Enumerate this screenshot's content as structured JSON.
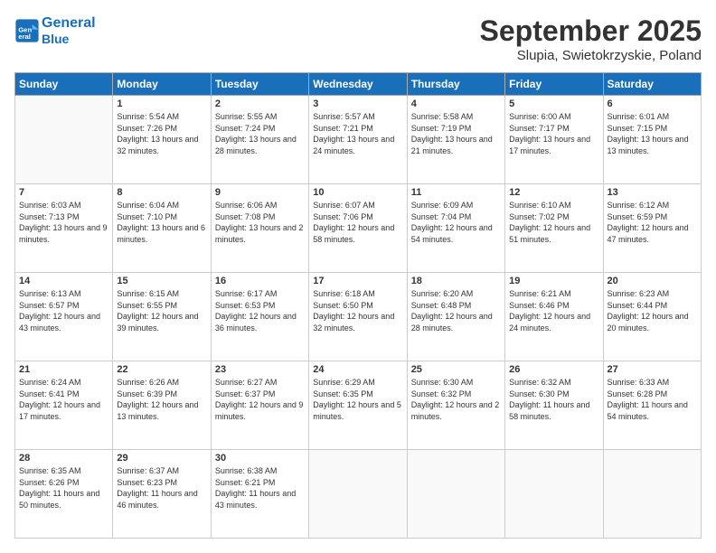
{
  "header": {
    "logo_line1": "General",
    "logo_line2": "Blue",
    "month": "September 2025",
    "location": "Slupia, Swietokrzyskie, Poland"
  },
  "weekdays": [
    "Sunday",
    "Monday",
    "Tuesday",
    "Wednesday",
    "Thursday",
    "Friday",
    "Saturday"
  ],
  "weeks": [
    [
      {
        "day": "",
        "sunrise": "",
        "sunset": "",
        "daylight": ""
      },
      {
        "day": "1",
        "sunrise": "Sunrise: 5:54 AM",
        "sunset": "Sunset: 7:26 PM",
        "daylight": "Daylight: 13 hours and 32 minutes."
      },
      {
        "day": "2",
        "sunrise": "Sunrise: 5:55 AM",
        "sunset": "Sunset: 7:24 PM",
        "daylight": "Daylight: 13 hours and 28 minutes."
      },
      {
        "day": "3",
        "sunrise": "Sunrise: 5:57 AM",
        "sunset": "Sunset: 7:21 PM",
        "daylight": "Daylight: 13 hours and 24 minutes."
      },
      {
        "day": "4",
        "sunrise": "Sunrise: 5:58 AM",
        "sunset": "Sunset: 7:19 PM",
        "daylight": "Daylight: 13 hours and 21 minutes."
      },
      {
        "day": "5",
        "sunrise": "Sunrise: 6:00 AM",
        "sunset": "Sunset: 7:17 PM",
        "daylight": "Daylight: 13 hours and 17 minutes."
      },
      {
        "day": "6",
        "sunrise": "Sunrise: 6:01 AM",
        "sunset": "Sunset: 7:15 PM",
        "daylight": "Daylight: 13 hours and 13 minutes."
      }
    ],
    [
      {
        "day": "7",
        "sunrise": "Sunrise: 6:03 AM",
        "sunset": "Sunset: 7:13 PM",
        "daylight": "Daylight: 13 hours and 9 minutes."
      },
      {
        "day": "8",
        "sunrise": "Sunrise: 6:04 AM",
        "sunset": "Sunset: 7:10 PM",
        "daylight": "Daylight: 13 hours and 6 minutes."
      },
      {
        "day": "9",
        "sunrise": "Sunrise: 6:06 AM",
        "sunset": "Sunset: 7:08 PM",
        "daylight": "Daylight: 13 hours and 2 minutes."
      },
      {
        "day": "10",
        "sunrise": "Sunrise: 6:07 AM",
        "sunset": "Sunset: 7:06 PM",
        "daylight": "Daylight: 12 hours and 58 minutes."
      },
      {
        "day": "11",
        "sunrise": "Sunrise: 6:09 AM",
        "sunset": "Sunset: 7:04 PM",
        "daylight": "Daylight: 12 hours and 54 minutes."
      },
      {
        "day": "12",
        "sunrise": "Sunrise: 6:10 AM",
        "sunset": "Sunset: 7:02 PM",
        "daylight": "Daylight: 12 hours and 51 minutes."
      },
      {
        "day": "13",
        "sunrise": "Sunrise: 6:12 AM",
        "sunset": "Sunset: 6:59 PM",
        "daylight": "Daylight: 12 hours and 47 minutes."
      }
    ],
    [
      {
        "day": "14",
        "sunrise": "Sunrise: 6:13 AM",
        "sunset": "Sunset: 6:57 PM",
        "daylight": "Daylight: 12 hours and 43 minutes."
      },
      {
        "day": "15",
        "sunrise": "Sunrise: 6:15 AM",
        "sunset": "Sunset: 6:55 PM",
        "daylight": "Daylight: 12 hours and 39 minutes."
      },
      {
        "day": "16",
        "sunrise": "Sunrise: 6:17 AM",
        "sunset": "Sunset: 6:53 PM",
        "daylight": "Daylight: 12 hours and 36 minutes."
      },
      {
        "day": "17",
        "sunrise": "Sunrise: 6:18 AM",
        "sunset": "Sunset: 6:50 PM",
        "daylight": "Daylight: 12 hours and 32 minutes."
      },
      {
        "day": "18",
        "sunrise": "Sunrise: 6:20 AM",
        "sunset": "Sunset: 6:48 PM",
        "daylight": "Daylight: 12 hours and 28 minutes."
      },
      {
        "day": "19",
        "sunrise": "Sunrise: 6:21 AM",
        "sunset": "Sunset: 6:46 PM",
        "daylight": "Daylight: 12 hours and 24 minutes."
      },
      {
        "day": "20",
        "sunrise": "Sunrise: 6:23 AM",
        "sunset": "Sunset: 6:44 PM",
        "daylight": "Daylight: 12 hours and 20 minutes."
      }
    ],
    [
      {
        "day": "21",
        "sunrise": "Sunrise: 6:24 AM",
        "sunset": "Sunset: 6:41 PM",
        "daylight": "Daylight: 12 hours and 17 minutes."
      },
      {
        "day": "22",
        "sunrise": "Sunrise: 6:26 AM",
        "sunset": "Sunset: 6:39 PM",
        "daylight": "Daylight: 12 hours and 13 minutes."
      },
      {
        "day": "23",
        "sunrise": "Sunrise: 6:27 AM",
        "sunset": "Sunset: 6:37 PM",
        "daylight": "Daylight: 12 hours and 9 minutes."
      },
      {
        "day": "24",
        "sunrise": "Sunrise: 6:29 AM",
        "sunset": "Sunset: 6:35 PM",
        "daylight": "Daylight: 12 hours and 5 minutes."
      },
      {
        "day": "25",
        "sunrise": "Sunrise: 6:30 AM",
        "sunset": "Sunset: 6:32 PM",
        "daylight": "Daylight: 12 hours and 2 minutes."
      },
      {
        "day": "26",
        "sunrise": "Sunrise: 6:32 AM",
        "sunset": "Sunset: 6:30 PM",
        "daylight": "Daylight: 11 hours and 58 minutes."
      },
      {
        "day": "27",
        "sunrise": "Sunrise: 6:33 AM",
        "sunset": "Sunset: 6:28 PM",
        "daylight": "Daylight: 11 hours and 54 minutes."
      }
    ],
    [
      {
        "day": "28",
        "sunrise": "Sunrise: 6:35 AM",
        "sunset": "Sunset: 6:26 PM",
        "daylight": "Daylight: 11 hours and 50 minutes."
      },
      {
        "day": "29",
        "sunrise": "Sunrise: 6:37 AM",
        "sunset": "Sunset: 6:23 PM",
        "daylight": "Daylight: 11 hours and 46 minutes."
      },
      {
        "day": "30",
        "sunrise": "Sunrise: 6:38 AM",
        "sunset": "Sunset: 6:21 PM",
        "daylight": "Daylight: 11 hours and 43 minutes."
      },
      {
        "day": "",
        "sunrise": "",
        "sunset": "",
        "daylight": ""
      },
      {
        "day": "",
        "sunrise": "",
        "sunset": "",
        "daylight": ""
      },
      {
        "day": "",
        "sunrise": "",
        "sunset": "",
        "daylight": ""
      },
      {
        "day": "",
        "sunrise": "",
        "sunset": "",
        "daylight": ""
      }
    ]
  ]
}
